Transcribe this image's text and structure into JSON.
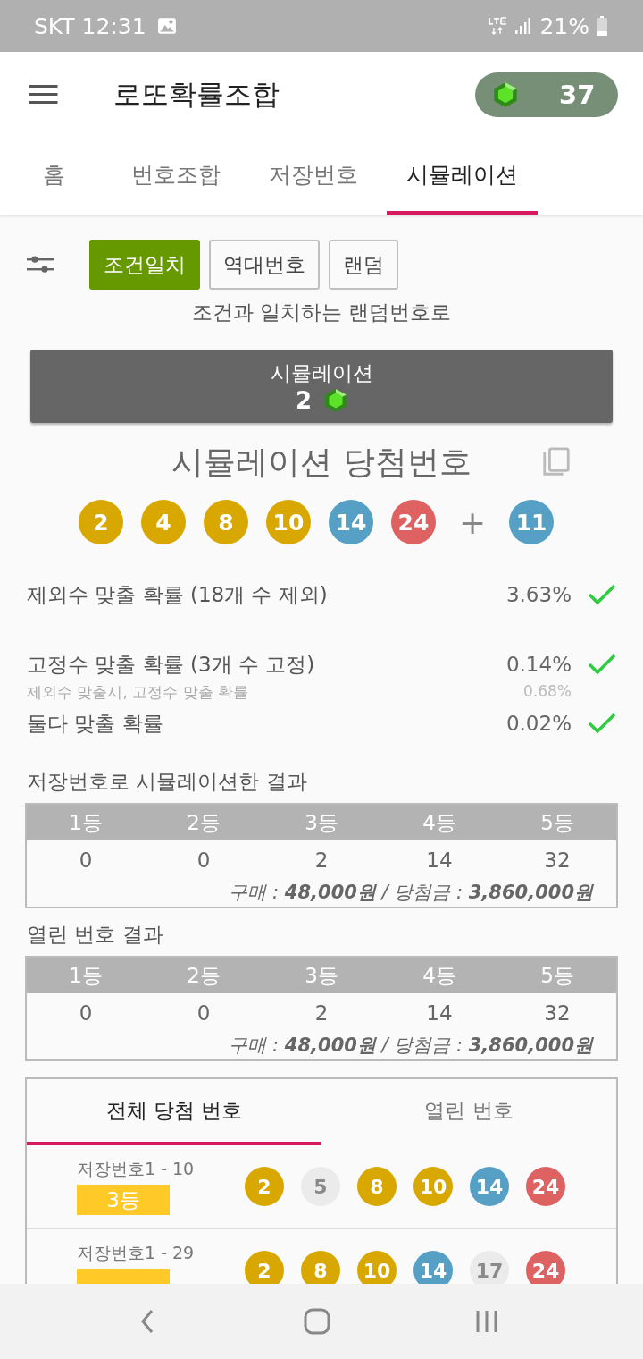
{
  "status_bar": {
    "carrier_time": "SKT 12:31",
    "battery": "21%"
  },
  "app_bar": {
    "title": "로또확률조합",
    "gems": "37"
  },
  "tabs": [
    {
      "label": "홈",
      "selected": false
    },
    {
      "label": "번호조합",
      "selected": false
    },
    {
      "label": "저장번호",
      "selected": false
    },
    {
      "label": "시뮬레이션",
      "selected": true
    }
  ],
  "modes": [
    {
      "label": "조건일치",
      "selected": true
    },
    {
      "label": "역대번호",
      "selected": false
    },
    {
      "label": "랜덤",
      "selected": false
    }
  ],
  "mode_description": "조건과 일치하는 랜덤번호로",
  "simulate_button": {
    "label": "시뮬레이션",
    "cost": "2"
  },
  "winning": {
    "title": "시뮬레이션 당첨번호",
    "balls": [
      {
        "number": "2",
        "color": "#d9a800"
      },
      {
        "number": "4",
        "color": "#d9a800"
      },
      {
        "number": "8",
        "color": "#d9a800"
      },
      {
        "number": "10",
        "color": "#d9a800"
      },
      {
        "number": "14",
        "color": "#55a0c4"
      },
      {
        "number": "24",
        "color": "#de6262"
      }
    ],
    "plus": "+",
    "bonus": {
      "number": "11",
      "color": "#55a0c4"
    }
  },
  "probabilities": [
    {
      "kind": "prob",
      "label": "제외수 맞출 확률 (18개 수 제외)",
      "value": "3.63%",
      "checked": true
    },
    {
      "kind": "prob",
      "label": "고정수 맞출 확률 (3개 수 고정)",
      "value": "0.14%",
      "checked": true
    },
    {
      "kind": "note",
      "label": "제외수 맞출시, 고정수 맞출 확률",
      "value": "0.68%"
    },
    {
      "kind": "prob",
      "label": "둘다 맞출 확률",
      "value": "0.02%",
      "checked": true
    }
  ],
  "results": [
    {
      "title": "저장번호로 시뮬레이션한 결과",
      "headers": [
        "1등",
        "2등",
        "3등",
        "4등",
        "5등"
      ],
      "values": [
        "0",
        "0",
        "2",
        "14",
        "32"
      ],
      "summary": "구매 : **48,000원** /  당첨금 : **3,860,000원**"
    },
    {
      "title": "열린 번호 결과",
      "headers": [
        "1등",
        "2등",
        "3등",
        "4등",
        "5등"
      ],
      "values": [
        "0",
        "0",
        "2",
        "14",
        "32"
      ],
      "summary": "구매 : **48,000원** /  당첨금 : **3,860,000원**"
    }
  ],
  "list_tabs": [
    {
      "label": "전체 당첨 번호",
      "selected": true
    },
    {
      "label": "열린 번호",
      "selected": false
    }
  ],
  "list_rows": [
    {
      "name": "저장번호1 - 10",
      "rank": "3등",
      "balls": [
        {
          "number": "2",
          "color": "#d9a800"
        },
        {
          "number": "5",
          "color": "#ebebeb",
          "matched": false
        },
        {
          "number": "8",
          "color": "#d9a800"
        },
        {
          "number": "10",
          "color": "#d9a800"
        },
        {
          "number": "14",
          "color": "#55a0c4"
        },
        {
          "number": "24",
          "color": "#de6262"
        }
      ]
    },
    {
      "name": "저장번호1 - 29",
      "rank_badge": true,
      "balls": [
        {
          "number": "2",
          "color": "#d9a800"
        },
        {
          "number": "8",
          "color": "#d9a800"
        },
        {
          "number": "10",
          "color": "#d9a800"
        },
        {
          "number": "14",
          "color": "#55a0c4"
        },
        {
          "number": "17",
          "color": "#ebebeb",
          "matched": false
        },
        {
          "number": "24",
          "color": "#de6262"
        }
      ]
    }
  ]
}
